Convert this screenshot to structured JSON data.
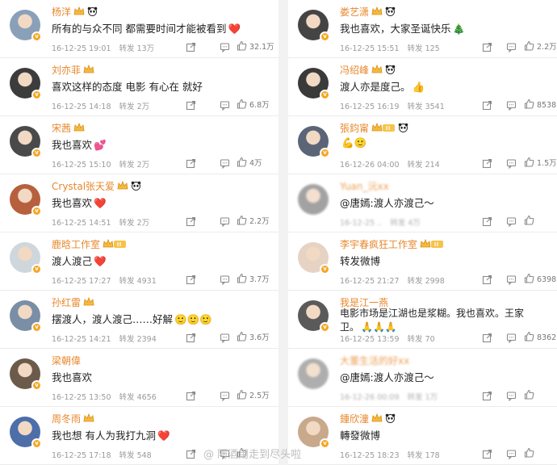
{
  "left_comments": [
    {
      "user": "杨洋",
      "text": "所有的与众不同 都需要时间才能被看到",
      "emoji": "❤️",
      "time": "16-12-25 19:01",
      "repost_label": "转发",
      "reposts": "13万",
      "likes": "32.1万",
      "avatar_color": "#8aa0b8",
      "badges": [
        "crown",
        "panda"
      ]
    },
    {
      "user": "刘亦菲",
      "text": "喜欢这样的态度 电影 有心在 就好",
      "emoji": "",
      "time": "16-12-25 14:18",
      "repost_label": "转发",
      "reposts": "2万",
      "likes": "6.8万",
      "avatar_color": "#3c3c3c",
      "badges": [
        "crown"
      ]
    },
    {
      "user": "宋茜",
      "text": "我也喜欢",
      "emoji": "💕",
      "time": "16-12-25 15:10",
      "repost_label": "转发",
      "reposts": "2万",
      "likes": "4万",
      "avatar_color": "#4a4a4a",
      "badges": [
        "crown"
      ]
    },
    {
      "user": "Crystal张天爱",
      "text": "我也喜欢",
      "emoji": "❤️",
      "time": "16-12-25 14:51",
      "repost_label": "转发",
      "reposts": "2万",
      "likes": "2.2万",
      "avatar_color": "#b7603e",
      "badges": [
        "crown",
        "panda"
      ]
    },
    {
      "user": "鹿晗工作室",
      "text": "渡人渡己",
      "emoji": "❤️",
      "time": "16-12-25 17:27",
      "repost_label": "转发",
      "reposts": "4931",
      "likes": "3.7万",
      "avatar_color": "#cfd6dc",
      "badges": [
        "crown-rank"
      ]
    },
    {
      "user": "孙红雷",
      "text": "摆渡人，渡人渡己……好解",
      "emoji": "🙂🙂🙂",
      "time": "16-12-25 14:21",
      "repost_label": "转发",
      "reposts": "2394",
      "likes": "3.6万",
      "avatar_color": "#7a8ea6",
      "badges": [
        "crown"
      ]
    },
    {
      "user": "梁朝偉",
      "text": "我也喜欢",
      "emoji": "",
      "time": "16-12-25 13:50",
      "repost_label": "转发",
      "reposts": "4656",
      "likes": "2.5万",
      "avatar_color": "#6c5a4a",
      "badges": []
    },
    {
      "user": "周冬雨",
      "text": "我也想 有人为我打九洞",
      "emoji": "❤️",
      "time": "16-12-25 17:18",
      "repost_label": "转发",
      "reposts": "548",
      "likes": "",
      "avatar_color": "#4d6ea8",
      "badges": [
        "crown"
      ]
    }
  ],
  "right_comments": [
    {
      "user": "娄艺潇",
      "text": "我也喜欢，大家圣诞快乐",
      "emoji": "🎄",
      "time": "16-12-25 15:51",
      "repost_label": "转发",
      "reposts": "125",
      "likes": "2.2万",
      "avatar_color": "#444444",
      "badges": [
        "crown",
        "panda"
      ]
    },
    {
      "user": "冯绍峰",
      "text": "渡人亦是度己。",
      "emoji": "👍",
      "time": "16-12-25 16:19",
      "repost_label": "转发",
      "reposts": "3541",
      "likes": "8538",
      "avatar_color": "#3a3a3a",
      "badges": [
        "crown",
        "panda"
      ]
    },
    {
      "user": "張鈞甯",
      "text": "",
      "emoji": "💪🙂",
      "time": "16-12-26 04:00",
      "repost_label": "转发",
      "reposts": "214",
      "likes": "1.5万",
      "avatar_color": "#5b6577",
      "badges": [
        "crown-rank",
        "panda"
      ]
    },
    {
      "user": "Yuan_沅xx",
      "text": "@唐嫣:渡人亦渡己～",
      "emoji": "",
      "time": "16-12-25 ..",
      "repost_label": "转发",
      "reposts": "4万",
      "likes": "",
      "avatar_color": "#8c8c8c",
      "badges": [],
      "blurred": true
    },
    {
      "user": "李宇春疯狂工作室",
      "text": "转发微博",
      "emoji": "",
      "time": "16-12-25 21:27",
      "repost_label": "转发",
      "reposts": "2998",
      "likes": "6398",
      "avatar_color": "#e6d3c3",
      "badges": [
        "crown-rank"
      ]
    },
    {
      "user": "我是江一燕",
      "text": "电影市场是江湖也是浆糊。我也喜欢。王家",
      "text2": "卫。",
      "emoji2": "🙏🙏🙏",
      "time": "16-12-25 13:59",
      "repost_label": "转发",
      "reposts": "70",
      "likes": "8362",
      "avatar_color": "#5a5a5a",
      "badges": []
    },
    {
      "user": "大董生活的好xx",
      "text": "@唐嫣:渡人亦渡己～",
      "emoji": "",
      "time": "16-12-26 00:09",
      "repost_label": "转发",
      "reposts": "1万",
      "likes": "",
      "avatar_color": "#9a9a9a",
      "badges": [],
      "blurred": true
    },
    {
      "user": "鍾欣潼",
      "text": "轉發微博",
      "emoji": "",
      "time": "16-12-25 18:23",
      "repost_label": "转发",
      "reposts": "178",
      "likes": "",
      "avatar_color": "#c9a98c",
      "badges": [
        "crown",
        "panda"
      ]
    }
  ],
  "watermark": "@ 阿酒用走到尽头啦",
  "colors": {
    "name": "#e8872c",
    "meta": "#9a9a9a",
    "verified": "#f5a623"
  }
}
